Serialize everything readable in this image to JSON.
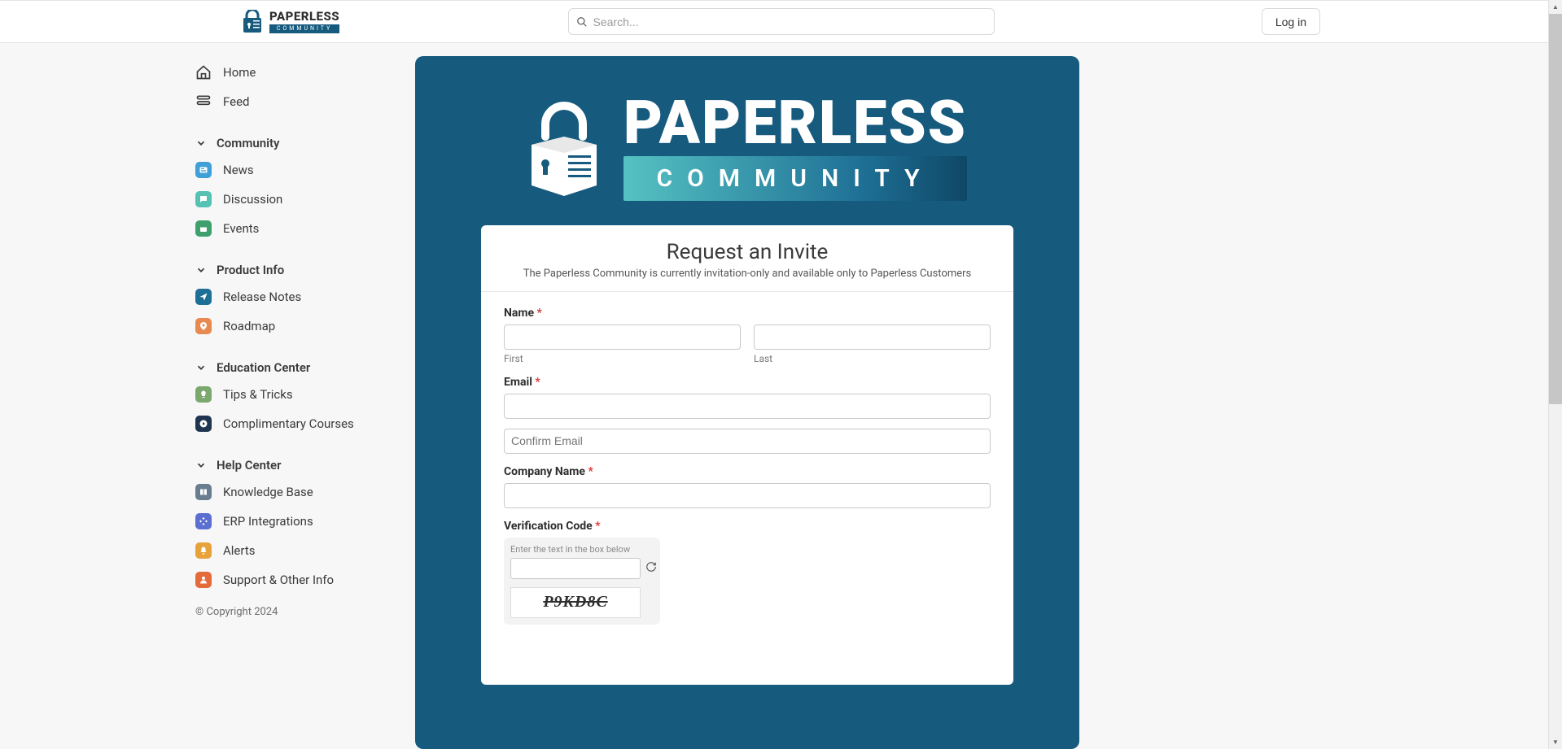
{
  "brand": {
    "name": "PAPERLESS",
    "tag": "COMMUNITY",
    "accent": "#165a7e"
  },
  "topbar": {
    "search_placeholder": "Search...",
    "login_label": "Log in"
  },
  "sidebar": {
    "items": [
      {
        "icon": "home",
        "label": "Home"
      },
      {
        "icon": "feed",
        "label": "Feed"
      }
    ],
    "sections": [
      {
        "title": "Community",
        "items": [
          {
            "icon": "news",
            "color": "#3fa0d8",
            "label": "News"
          },
          {
            "icon": "discussion",
            "color": "#55c2b4",
            "label": "Discussion"
          },
          {
            "icon": "events",
            "color": "#3fa06e",
            "label": "Events"
          }
        ]
      },
      {
        "title": "Product Info",
        "items": [
          {
            "icon": "release",
            "color": "#1e6f95",
            "label": "Release Notes"
          },
          {
            "icon": "roadmap",
            "color": "#e78a51",
            "label": "Roadmap"
          }
        ]
      },
      {
        "title": "Education Center",
        "items": [
          {
            "icon": "tips",
            "color": "#7ba86e",
            "label": "Tips & Tricks"
          },
          {
            "icon": "courses",
            "color": "#1e344f",
            "label": "Complimentary Courses"
          }
        ]
      },
      {
        "title": "Help Center",
        "items": [
          {
            "icon": "kb",
            "color": "#6a7d90",
            "label": "Knowledge Base"
          },
          {
            "icon": "erp",
            "color": "#5a6fcf",
            "label": "ERP Integrations"
          },
          {
            "icon": "alerts",
            "color": "#e7a23b",
            "label": "Alerts"
          },
          {
            "icon": "support",
            "color": "#e46b3a",
            "label": "Support & Other Info"
          }
        ]
      }
    ],
    "copyright": "© Copyright 2024"
  },
  "hero": {
    "title": "PAPERLESS",
    "tag": "COMMUNITY"
  },
  "form": {
    "title": "Request an Invite",
    "subtitle": "The Paperless Community is currently invitation-only and available only to Paperless Customers",
    "name_label": "Name",
    "first_sub": "First",
    "last_sub": "Last",
    "email_label": "Email",
    "confirm_email_placeholder": "Confirm Email",
    "company_label": "Company Name",
    "verification_label": "Verification Code",
    "captcha_hint": "Enter the text in the box below",
    "captcha_value": "P9KD8C",
    "required_marker": "*"
  }
}
